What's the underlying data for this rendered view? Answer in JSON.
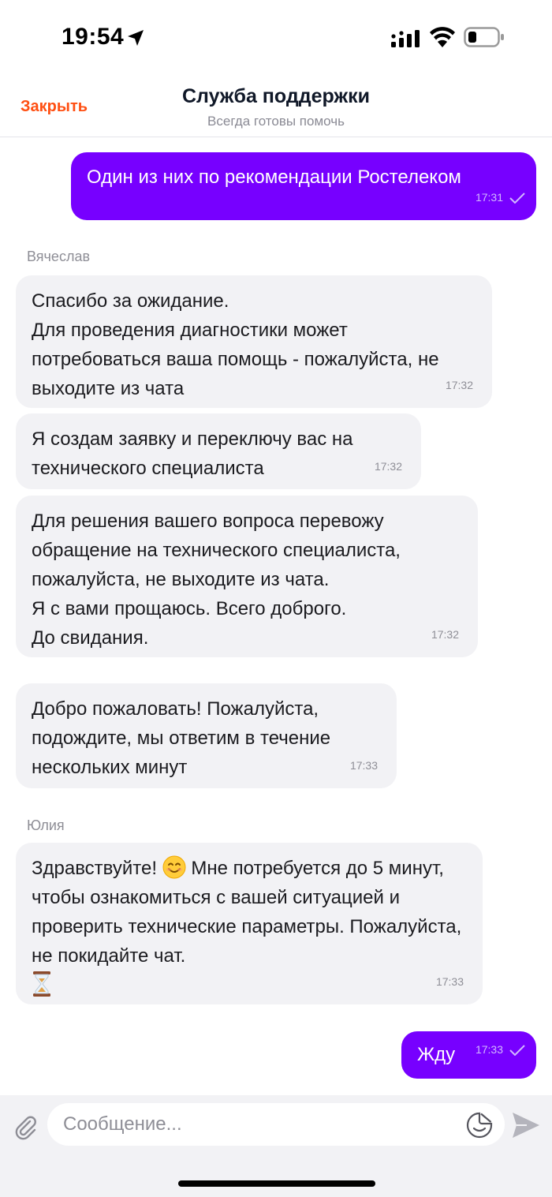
{
  "status_bar": {
    "time": "19:54"
  },
  "header": {
    "close_label": "Закрыть",
    "title": "Служба поддержки",
    "subtitle": "Всегда готовы помочь"
  },
  "messages": [
    {
      "direction": "out",
      "text": "Один из них по рекомендации Ростелеком",
      "time": "17:31",
      "status": "read"
    },
    {
      "sender": "Вячеслав"
    },
    {
      "direction": "in",
      "text": "Спасибо за ожидание.\nДля проведения диагностики может потребоваться ваша помощь - пожалуйста, не выходите из чата",
      "time": "17:32"
    },
    {
      "direction": "in",
      "text": "Я создам заявку и переключу вас на технического специалиста",
      "time": "17:32"
    },
    {
      "direction": "in",
      "text": "Для решения вашего вопроса перевожу обращение на технического специалиста, пожалуйста, не выходите из чата.\nЯ с вами прощаюсь. Всего доброго.\nДо свидания.",
      "time": "17:32"
    },
    {
      "direction": "in",
      "text": "Добро пожаловать! Пожалуйста, подождите, мы ответим в течение нескольких минут",
      "time": "17:33"
    },
    {
      "sender": "Юлия"
    },
    {
      "direction": "in",
      "text_before_emoji": "Здравствуйте! ",
      "emoji": "smiling-face",
      "text_after_emoji": " Мне потребуется до 5 минут, чтобы ознакомиться с вашей ситуацией и проверить технические параметры. Пожалуйста, не покидайте чат.",
      "trailing_emoji": "hourglass",
      "time": "17:33"
    },
    {
      "direction": "out",
      "text": "Жду",
      "time": "17:33",
      "status": "read"
    }
  ],
  "composer": {
    "placeholder": "Сообщение...",
    "value": ""
  },
  "colors": {
    "accent_orange": "#ff4f12",
    "outgoing_bubble": "#7700ff",
    "incoming_bubble": "#f2f2f5"
  }
}
